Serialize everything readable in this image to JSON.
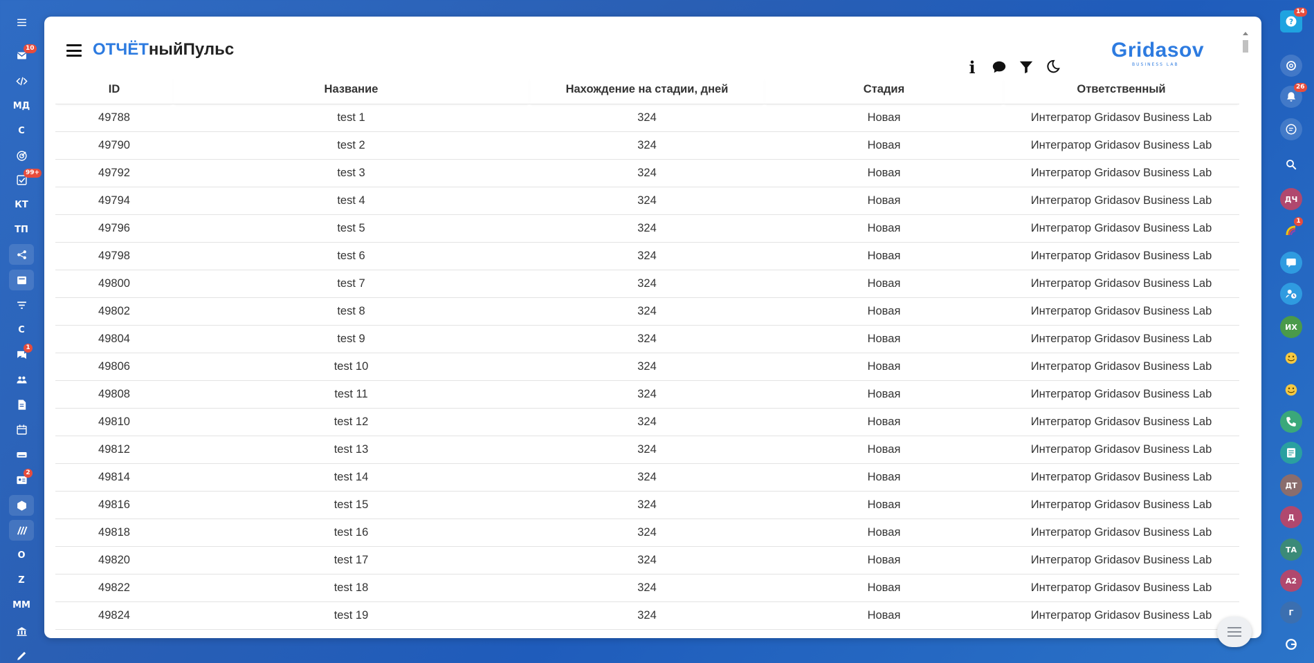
{
  "app": {
    "title_part1": "ОТЧЁТ",
    "title_part2": "ныйПульс",
    "logo_text": "Gridasov",
    "logo_sub": "BUSINESS LAB",
    "accent": "#2d7be0"
  },
  "left_sidebar": [
    {
      "icon": "hamburger-icon"
    },
    {
      "icon": "mail-icon",
      "badge": "10"
    },
    {
      "icon": "code-icon"
    },
    {
      "label": "МД"
    },
    {
      "label": "С"
    },
    {
      "icon": "target-icon"
    },
    {
      "icon": "task-check-icon",
      "badge": "99+"
    },
    {
      "label": "КТ"
    },
    {
      "label": "ТП"
    },
    {
      "icon": "share-nodes-icon"
    },
    {
      "icon": "card-icon"
    },
    {
      "icon": "filter-lines-icon"
    },
    {
      "label": "С"
    },
    {
      "icon": "chat-icon",
      "badge": "1"
    },
    {
      "icon": "users-icon"
    },
    {
      "icon": "document-icon"
    },
    {
      "icon": "calendar-icon"
    },
    {
      "icon": "drive-icon"
    },
    {
      "icon": "contact-card-icon",
      "badge": "2"
    },
    {
      "icon": "box-icon"
    },
    {
      "icon": "stripes-icon"
    },
    {
      "label": "О"
    },
    {
      "label": "Z"
    },
    {
      "label": "ММ"
    },
    {
      "icon": "bank-icon"
    },
    {
      "icon": "pen-icon"
    }
  ],
  "right_sidebar": [
    {
      "icon": "help-icon",
      "badge": "14"
    },
    {
      "icon": "spiral-icon"
    },
    {
      "icon": "bell-icon",
      "badge": "26"
    },
    {
      "icon": "chat-bubble-icon"
    },
    {
      "icon": "search-icon"
    },
    {
      "label": "ДЧ"
    },
    {
      "icon": "colorful-app-icon",
      "badge": "1"
    },
    {
      "icon": "message-icon"
    },
    {
      "icon": "user-clock-icon"
    },
    {
      "label": "ИХ"
    },
    {
      "icon": "smiley-icon"
    },
    {
      "icon": "smiley-icon"
    },
    {
      "icon": "phone-icon"
    },
    {
      "icon": "notes-icon"
    },
    {
      "label": "ДТ"
    },
    {
      "label": "Д"
    },
    {
      "label": "ТА"
    },
    {
      "label": "А2"
    },
    {
      "label": "Г"
    },
    {
      "icon": "spiral-logo-icon"
    }
  ],
  "toolbar": {
    "info": "i",
    "chat": "chat-icon",
    "filter": "filter-icon",
    "theme": "moon-icon"
  },
  "table": {
    "headers": [
      "ID",
      "Название",
      "Нахождение на стадии, дней",
      "Стадия",
      "Ответственный"
    ],
    "rows": [
      [
        "49788",
        "test 1",
        "324",
        "Новая",
        "Интегратор Gridasov Business Lab"
      ],
      [
        "49790",
        "test 2",
        "324",
        "Новая",
        "Интегратор Gridasov Business Lab"
      ],
      [
        "49792",
        "test 3",
        "324",
        "Новая",
        "Интегратор Gridasov Business Lab"
      ],
      [
        "49794",
        "test 4",
        "324",
        "Новая",
        "Интегратор Gridasov Business Lab"
      ],
      [
        "49796",
        "test 5",
        "324",
        "Новая",
        "Интегратор Gridasov Business Lab"
      ],
      [
        "49798",
        "test 6",
        "324",
        "Новая",
        "Интегратор Gridasov Business Lab"
      ],
      [
        "49800",
        "test 7",
        "324",
        "Новая",
        "Интегратор Gridasov Business Lab"
      ],
      [
        "49802",
        "test 8",
        "324",
        "Новая",
        "Интегратор Gridasov Business Lab"
      ],
      [
        "49804",
        "test 9",
        "324",
        "Новая",
        "Интегратор Gridasov Business Lab"
      ],
      [
        "49806",
        "test 10",
        "324",
        "Новая",
        "Интегратор Gridasov Business Lab"
      ],
      [
        "49808",
        "test 11",
        "324",
        "Новая",
        "Интегратор Gridasov Business Lab"
      ],
      [
        "49810",
        "test 12",
        "324",
        "Новая",
        "Интегратор Gridasov Business Lab"
      ],
      [
        "49812",
        "test 13",
        "324",
        "Новая",
        "Интегратор Gridasov Business Lab"
      ],
      [
        "49814",
        "test 14",
        "324",
        "Новая",
        "Интегратор Gridasov Business Lab"
      ],
      [
        "49816",
        "test 15",
        "324",
        "Новая",
        "Интегратор Gridasov Business Lab"
      ],
      [
        "49818",
        "test 16",
        "324",
        "Новая",
        "Интегратор Gridasov Business Lab"
      ],
      [
        "49820",
        "test 17",
        "324",
        "Новая",
        "Интегратор Gridasov Business Lab"
      ],
      [
        "49822",
        "test 18",
        "324",
        "Новая",
        "Интегратор Gridasov Business Lab"
      ],
      [
        "49824",
        "test 19",
        "324",
        "Новая",
        "Интегратор Gridasov Business Lab"
      ]
    ]
  }
}
